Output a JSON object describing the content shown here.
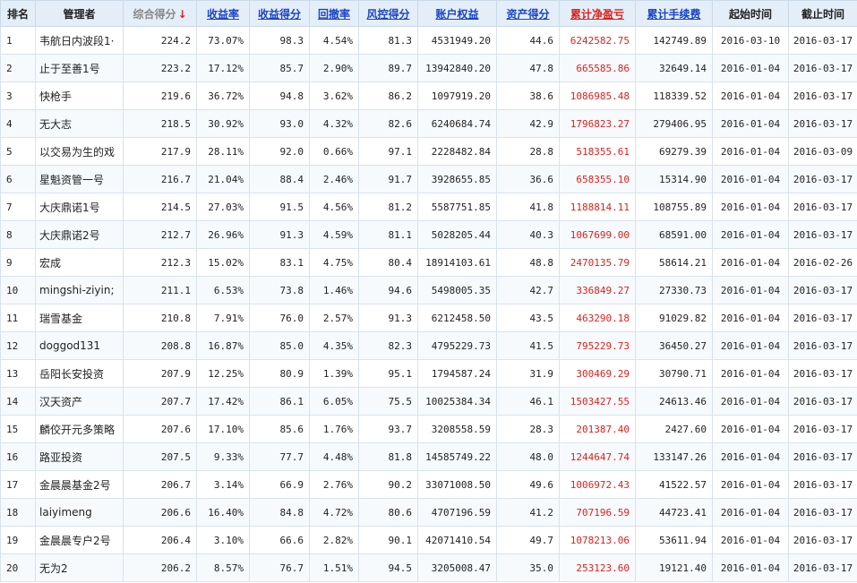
{
  "headers": {
    "rank": "排名",
    "manager": "管理者",
    "score": "综合得分",
    "sort_arrow": "↓",
    "return_rate": "收益率",
    "return_score": "收益得分",
    "drawdown": "回撤率",
    "risk_score": "风控得分",
    "equity": "账户权益",
    "asset_score": "资产得分",
    "pnl": "累计净盈亏",
    "fee": "累计手续费",
    "start": "起始时间",
    "end": "截止时间"
  },
  "colors": {
    "accent_red": "#e0201c",
    "header_bg": "#e3eef8",
    "link_blue": "#1a43c8"
  },
  "rows": [
    {
      "rank": "1",
      "manager": "韦航日内波段1·",
      "score": "224.2",
      "return_rate": "73.07%",
      "return_score": "98.3",
      "drawdown": "4.54%",
      "risk_score": "81.3",
      "equity": "4531949.20",
      "asset_score": "44.6",
      "pnl": "6242582.75",
      "fee": "142749.89",
      "start": "2016-03-10",
      "end": "2016-03-17"
    },
    {
      "rank": "2",
      "manager": "止于至善1号",
      "score": "223.2",
      "return_rate": "17.12%",
      "return_score": "85.7",
      "drawdown": "2.90%",
      "risk_score": "89.7",
      "equity": "13942840.20",
      "asset_score": "47.8",
      "pnl": "665585.86",
      "fee": "32649.14",
      "start": "2016-01-04",
      "end": "2016-03-17"
    },
    {
      "rank": "3",
      "manager": "快枪手",
      "score": "219.6",
      "return_rate": "36.72%",
      "return_score": "94.8",
      "drawdown": "3.62%",
      "risk_score": "86.2",
      "equity": "1097919.20",
      "asset_score": "38.6",
      "pnl": "1086985.48",
      "fee": "118339.52",
      "start": "2016-01-04",
      "end": "2016-03-17"
    },
    {
      "rank": "4",
      "manager": "无大志",
      "score": "218.5",
      "return_rate": "30.92%",
      "return_score": "93.0",
      "drawdown": "4.32%",
      "risk_score": "82.6",
      "equity": "6240684.74",
      "asset_score": "42.9",
      "pnl": "1796823.27",
      "fee": "279406.95",
      "start": "2016-01-04",
      "end": "2016-03-17"
    },
    {
      "rank": "5",
      "manager": "以交易为生的戏",
      "score": "217.9",
      "return_rate": "28.11%",
      "return_score": "92.0",
      "drawdown": "0.66%",
      "risk_score": "97.1",
      "equity": "2228482.84",
      "asset_score": "28.8",
      "pnl": "518355.61",
      "fee": "69279.39",
      "start": "2016-01-04",
      "end": "2016-03-09"
    },
    {
      "rank": "6",
      "manager": "星魁资管一号",
      "score": "216.7",
      "return_rate": "21.04%",
      "return_score": "88.4",
      "drawdown": "2.46%",
      "risk_score": "91.7",
      "equity": "3928655.85",
      "asset_score": "36.6",
      "pnl": "658355.10",
      "fee": "15314.90",
      "start": "2016-01-04",
      "end": "2016-03-17"
    },
    {
      "rank": "7",
      "manager": "大庆鼎诺1号",
      "score": "214.5",
      "return_rate": "27.03%",
      "return_score": "91.5",
      "drawdown": "4.56%",
      "risk_score": "81.2",
      "equity": "5587751.85",
      "asset_score": "41.8",
      "pnl": "1188814.11",
      "fee": "108755.89",
      "start": "2016-01-04",
      "end": "2016-03-17"
    },
    {
      "rank": "8",
      "manager": "大庆鼎诺2号",
      "score": "212.7",
      "return_rate": "26.96%",
      "return_score": "91.3",
      "drawdown": "4.59%",
      "risk_score": "81.1",
      "equity": "5028205.44",
      "asset_score": "40.3",
      "pnl": "1067699.00",
      "fee": "68591.00",
      "start": "2016-01-04",
      "end": "2016-03-17"
    },
    {
      "rank": "9",
      "manager": "宏成",
      "score": "212.3",
      "return_rate": "15.02%",
      "return_score": "83.1",
      "drawdown": "4.75%",
      "risk_score": "80.4",
      "equity": "18914103.61",
      "asset_score": "48.8",
      "pnl": "2470135.79",
      "fee": "58614.21",
      "start": "2016-01-04",
      "end": "2016-02-26"
    },
    {
      "rank": "10",
      "manager": "mingshi-ziyin;",
      "score": "211.1",
      "return_rate": "6.53%",
      "return_score": "73.8",
      "drawdown": "1.46%",
      "risk_score": "94.6",
      "equity": "5498005.35",
      "asset_score": "42.7",
      "pnl": "336849.27",
      "fee": "27330.73",
      "start": "2016-01-04",
      "end": "2016-03-17"
    },
    {
      "rank": "11",
      "manager": "瑞雪基金",
      "score": "210.8",
      "return_rate": "7.91%",
      "return_score": "76.0",
      "drawdown": "2.57%",
      "risk_score": "91.3",
      "equity": "6212458.50",
      "asset_score": "43.5",
      "pnl": "463290.18",
      "fee": "91029.82",
      "start": "2016-01-04",
      "end": "2016-03-17"
    },
    {
      "rank": "12",
      "manager": "doggod131",
      "score": "208.8",
      "return_rate": "16.87%",
      "return_score": "85.0",
      "drawdown": "4.35%",
      "risk_score": "82.3",
      "equity": "4795229.73",
      "asset_score": "41.5",
      "pnl": "795229.73",
      "fee": "36450.27",
      "start": "2016-01-04",
      "end": "2016-03-17"
    },
    {
      "rank": "13",
      "manager": "岳阳长安投资",
      "score": "207.9",
      "return_rate": "12.25%",
      "return_score": "80.9",
      "drawdown": "1.39%",
      "risk_score": "95.1",
      "equity": "1794587.24",
      "asset_score": "31.9",
      "pnl": "300469.29",
      "fee": "30790.71",
      "start": "2016-01-04",
      "end": "2016-03-17"
    },
    {
      "rank": "14",
      "manager": "汉天资产",
      "score": "207.7",
      "return_rate": "17.42%",
      "return_score": "86.1",
      "drawdown": "6.05%",
      "risk_score": "75.5",
      "equity": "10025384.34",
      "asset_score": "46.1",
      "pnl": "1503427.55",
      "fee": "24613.46",
      "start": "2016-01-04",
      "end": "2016-03-17"
    },
    {
      "rank": "15",
      "manager": "麟佼开元多策略",
      "score": "207.6",
      "return_rate": "17.10%",
      "return_score": "85.6",
      "drawdown": "1.76%",
      "risk_score": "93.7",
      "equity": "3208558.59",
      "asset_score": "28.3",
      "pnl": "201387.40",
      "fee": "2427.60",
      "start": "2016-01-04",
      "end": "2016-03-17"
    },
    {
      "rank": "16",
      "manager": "路亚投资",
      "score": "207.5",
      "return_rate": "9.33%",
      "return_score": "77.7",
      "drawdown": "4.48%",
      "risk_score": "81.8",
      "equity": "14585749.22",
      "asset_score": "48.0",
      "pnl": "1244647.74",
      "fee": "133147.26",
      "start": "2016-01-04",
      "end": "2016-03-17"
    },
    {
      "rank": "17",
      "manager": "金晨晨基金2号",
      "score": "206.7",
      "return_rate": "3.14%",
      "return_score": "66.9",
      "drawdown": "2.76%",
      "risk_score": "90.2",
      "equity": "33071008.50",
      "asset_score": "49.6",
      "pnl": "1006972.43",
      "fee": "41522.57",
      "start": "2016-01-04",
      "end": "2016-03-17"
    },
    {
      "rank": "18",
      "manager": "laiyimeng",
      "score": "206.6",
      "return_rate": "16.40%",
      "return_score": "84.8",
      "drawdown": "4.72%",
      "risk_score": "80.6",
      "equity": "4707196.59",
      "asset_score": "41.2",
      "pnl": "707196.59",
      "fee": "44723.41",
      "start": "2016-01-04",
      "end": "2016-03-17"
    },
    {
      "rank": "19",
      "manager": "金晨晨专户2号",
      "score": "206.4",
      "return_rate": "3.10%",
      "return_score": "66.6",
      "drawdown": "2.82%",
      "risk_score": "90.1",
      "equity": "42071410.54",
      "asset_score": "49.7",
      "pnl": "1078213.06",
      "fee": "53611.94",
      "start": "2016-01-04",
      "end": "2016-03-17"
    },
    {
      "rank": "20",
      "manager": "无为2",
      "score": "206.2",
      "return_rate": "8.57%",
      "return_score": "76.7",
      "drawdown": "1.51%",
      "risk_score": "94.5",
      "equity": "3205008.47",
      "asset_score": "35.0",
      "pnl": "253123.60",
      "fee": "19121.40",
      "start": "2016-01-04",
      "end": "2016-03-17"
    }
  ]
}
